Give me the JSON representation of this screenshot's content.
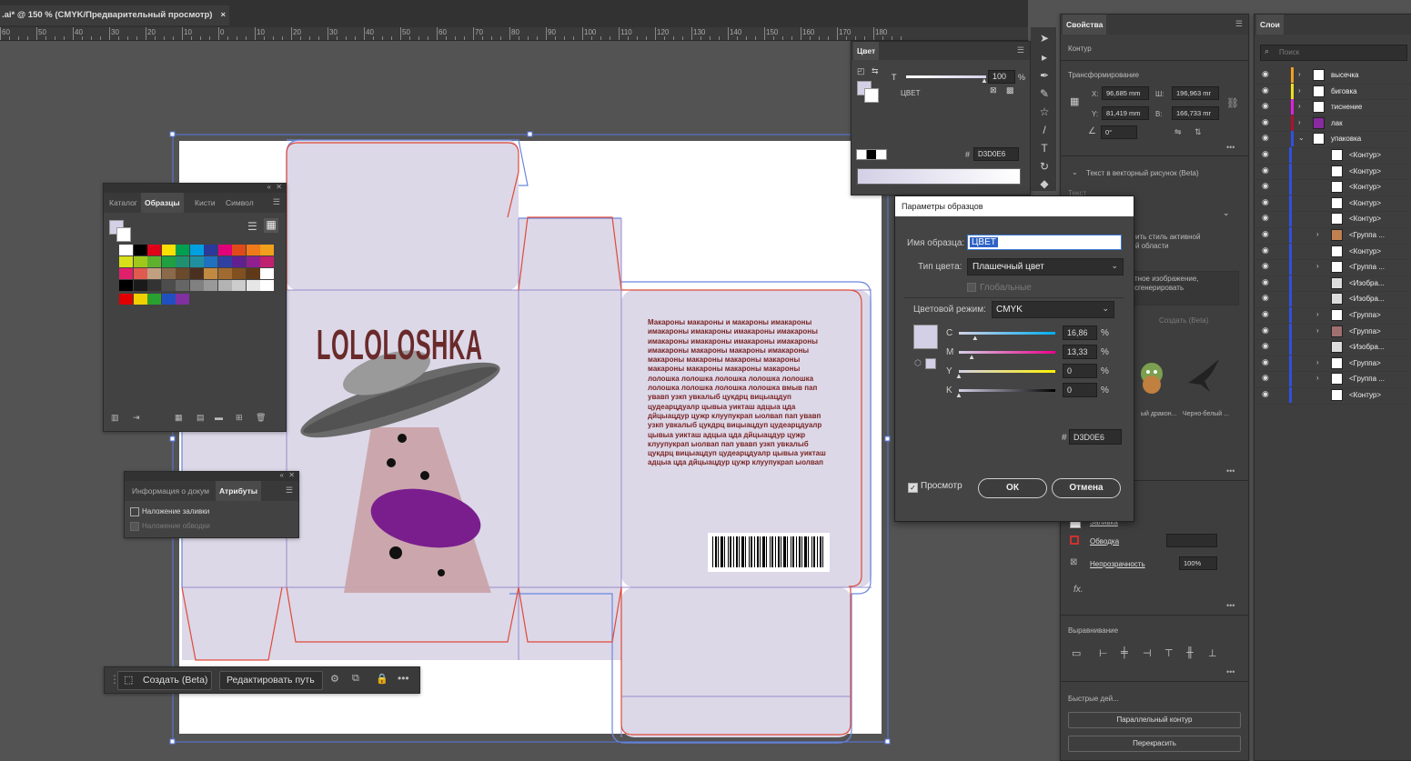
{
  "doc_tab": {
    "title": ".ai* @ 150 % (CMYK/Предварительный просмотр)",
    "close": "×"
  },
  "ruler_ticks": [
    "60",
    "50",
    "40",
    "30",
    "20",
    "10",
    "0",
    "10",
    "20",
    "30",
    "40",
    "50",
    "60",
    "70",
    "80",
    "90",
    "100",
    "110",
    "120",
    "130",
    "140",
    "150",
    "160",
    "170",
    "180"
  ],
  "package": {
    "logo": "LOLOLOSHKA",
    "body_text": "Макароны макароны и макароны имакароны имакароны имакароны имакароны имакароны имакароны имакароны имакароны имакароны имакароны макароны макароны имакароны макароны макароны макароны макароны макароны макароны макароны макароны лолошка лолошка лолошка лолошка лолошка лолошка лолошка лолошка лолошка вмыв пап увавп узкп увкалыб цукдрц вицыацдуп цудеарцдуалр цывыа уикташ адцыа цда дйцыацдур цужр клуупукрап ыолвап пап увавп узкп увкалыб цукдрц вицыацдуп цудеарцдуалр цывыа уикташ адцыа цда дйцыацдур цужр клуупукрап ыолвап пап увавп узкп увкалыб цукдрц вицыацдуп цудеарцдуалр цывыа уикташ адцыа цда дйцыацдур цужр клуупукрап ыолвап"
  },
  "swatches_panel": {
    "tabs": [
      "Каталог",
      "Образцы",
      "Кисти",
      "Символ"
    ],
    "colors_row1": [
      "#ffffff",
      "#000000",
      "#e0001a",
      "#f8e000",
      "#00a050",
      "#00a0e0",
      "#2a3a9a",
      "#e0007a",
      "#e04a1a",
      "#f07a1a",
      "#f0a01a"
    ],
    "colors_row2": [
      "#d8e01a",
      "#a0c81a",
      "#60b030",
      "#20a040",
      "#209070",
      "#2090a0",
      "#2070c0",
      "#3040a0",
      "#602090",
      "#902090",
      "#c02070"
    ],
    "colors_row3": [
      "#e0206a",
      "#e05a50",
      "#c0a080",
      "#8a6a4a",
      "#6a4a2a",
      "#4a3020",
      "#c08a40",
      "#a06a30",
      "#805020",
      "#603a18",
      "#fff"
    ],
    "grays": [
      "#000000",
      "#1a1a1a",
      "#333333",
      "#4d4d4d",
      "#666666",
      "#808080",
      "#999999",
      "#b3b3b3",
      "#cccccc",
      "#e6e6e6",
      "#ffffff"
    ]
  },
  "attributes_panel": {
    "tabs": [
      "Информация о докум",
      "Атрибуты"
    ],
    "fill_overprint": "Наложение заливки",
    "stroke_overprint": "Наложение обводки"
  },
  "bottom_bar": {
    "create": "Создать (Beta)",
    "edit_path": "Редактировать путь"
  },
  "color_panel": {
    "title": "Цвет",
    "channel": "T",
    "value": "100",
    "unit": "%",
    "color_label": "ЦВЕТ",
    "hex_sign": "#",
    "hex": "D3D0E6"
  },
  "swatch_dialog": {
    "title": "Параметры образцов",
    "name_label": "Имя образца:",
    "name_value": "ЦВЕТ",
    "type_label": "Тип цвета:",
    "type_value": "Плашечный цвет",
    "global_label": "Глобальные",
    "mode_label": "Цветовой режим:",
    "mode_value": "CMYK",
    "channels": [
      {
        "name": "C",
        "value": "16,86",
        "pct": 0.1686
      },
      {
        "name": "M",
        "value": "13,33",
        "pct": 0.1333
      },
      {
        "name": "Y",
        "value": "0",
        "pct": 0
      },
      {
        "name": "K",
        "value": "0",
        "pct": 0
      }
    ],
    "pct": "%",
    "hex_sign": "#",
    "hex": "D3D0E6",
    "swatch_color": "#d3d0e6",
    "preview_label": "Просмотр",
    "ok": "ОК",
    "cancel": "Отмена"
  },
  "properties": {
    "title": "Свойства",
    "kontur": "Контур",
    "transform": "Трансформирование",
    "x_label": "X:",
    "x": "96,685 mm",
    "y_label": "Y:",
    "y": "81,419 mm",
    "w_label": "Ш:",
    "w": "196,963 mr",
    "h_label": "В:",
    "h": "166,733 mr",
    "angle": "0°",
    "text_vector": "Текст в векторный рисунок (Beta)",
    "text_label": "Текст",
    "hint1": "ить стиль активной",
    "hint2": "й области",
    "hint3": "тное изображение,",
    "hint4": "сгенерировать",
    "create_beta": "Создать (Beta)",
    "img1": "ый дракон...",
    "img2": "Черно-белый ...",
    "fill": "Заливка",
    "stroke": "Обводка",
    "opacity": "Непрозрачность",
    "opacity_val": "100%",
    "fx": "fx.",
    "align": "Выравнивание",
    "quick": "Быстрые дей...",
    "offset": "Параллельный контур",
    "recolor": "Перекрасить"
  },
  "layers": {
    "title": "Слои",
    "search": "Поиск",
    "items": [
      {
        "name": "высечка",
        "color": "#f0a020",
        "indent": 0,
        "arrow": ">",
        "thumb": "#fff"
      },
      {
        "name": "биговка",
        "color": "#f0e020",
        "indent": 0,
        "arrow": ">",
        "thumb": "#fff"
      },
      {
        "name": "тиснение",
        "color": "#e020e0",
        "indent": 0,
        "arrow": ">",
        "thumb": "#fff"
      },
      {
        "name": "лак",
        "color": "#b01030",
        "indent": 0,
        "arrow": ">",
        "thumb": "#8a2aa0"
      },
      {
        "name": "упаковка",
        "color": "#3050e0",
        "indent": 0,
        "arrow": "v",
        "thumb": "#fff"
      },
      {
        "name": "<Контур>",
        "color": "#3050e0",
        "indent": 1,
        "arrow": "",
        "thumb": "#fff"
      },
      {
        "name": "<Контур>",
        "color": "#3050e0",
        "indent": 1,
        "arrow": "",
        "thumb": "#fff"
      },
      {
        "name": "<Контур>",
        "color": "#3050e0",
        "indent": 1,
        "arrow": "",
        "thumb": "#fff"
      },
      {
        "name": "<Контур>",
        "color": "#3050e0",
        "indent": 1,
        "arrow": "",
        "thumb": "#fff"
      },
      {
        "name": "<Контур>",
        "color": "#3050e0",
        "indent": 1,
        "arrow": "",
        "thumb": "#fff"
      },
      {
        "name": "<Группа ...",
        "color": "#3050e0",
        "indent": 1,
        "arrow": ">",
        "thumb": "#c08050"
      },
      {
        "name": "<Контур>",
        "color": "#3050e0",
        "indent": 1,
        "arrow": "",
        "thumb": "#fff"
      },
      {
        "name": "<Группа ...",
        "color": "#3050e0",
        "indent": 1,
        "arrow": ">",
        "thumb": "#fff"
      },
      {
        "name": "<Изобра...",
        "color": "#3050e0",
        "indent": 1,
        "arrow": "",
        "thumb": "#ddd"
      },
      {
        "name": "<Изобра...",
        "color": "#3050e0",
        "indent": 1,
        "arrow": "",
        "thumb": "#ddd"
      },
      {
        "name": "<Группа>",
        "color": "#3050e0",
        "indent": 1,
        "arrow": ">",
        "thumb": "#fff"
      },
      {
        "name": "<Группа>",
        "color": "#3050e0",
        "indent": 1,
        "arrow": ">",
        "thumb": "#a07070"
      },
      {
        "name": "<Изобра...",
        "color": "#3050e0",
        "indent": 1,
        "arrow": "",
        "thumb": "#ddd"
      },
      {
        "name": "<Группа>",
        "color": "#3050e0",
        "indent": 1,
        "arrow": ">",
        "thumb": "#fff"
      },
      {
        "name": "<Группа ...",
        "color": "#3050e0",
        "indent": 1,
        "arrow": ">",
        "thumb": "#fff"
      },
      {
        "name": "<Контур>",
        "color": "#3050e0",
        "indent": 1,
        "arrow": "",
        "thumb": "#fff"
      }
    ]
  }
}
